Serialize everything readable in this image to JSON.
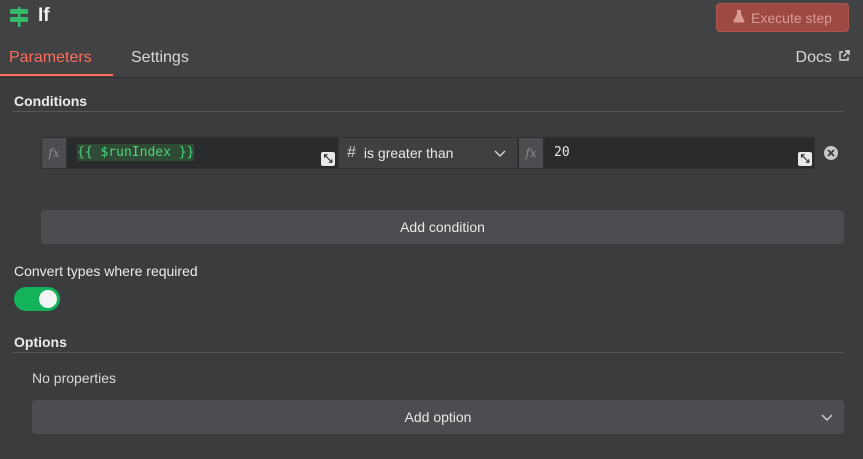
{
  "node": {
    "title": "If",
    "icon": "signpost-icon"
  },
  "header": {
    "execute_label": "Execute step",
    "tabs": [
      {
        "label": "Parameters",
        "active": true
      },
      {
        "label": "Settings",
        "active": false
      }
    ],
    "docs_label": "Docs"
  },
  "conditions": {
    "title": "Conditions",
    "rows": [
      {
        "left_prefix": "fx",
        "left_value": "{{ $runIndex }}",
        "operator_type": "#",
        "operator_label": "is greater than",
        "right_prefix": "fx",
        "right_value": "20"
      }
    ],
    "add_label": "Add condition"
  },
  "convert_types": {
    "label": "Convert types where required",
    "enabled": true
  },
  "options": {
    "title": "Options",
    "empty_text": "No properties",
    "add_label": "Add option"
  },
  "colors": {
    "accent": "#ff6d5a",
    "toggle_on": "#13b35a",
    "expression": "#4bd37f"
  }
}
